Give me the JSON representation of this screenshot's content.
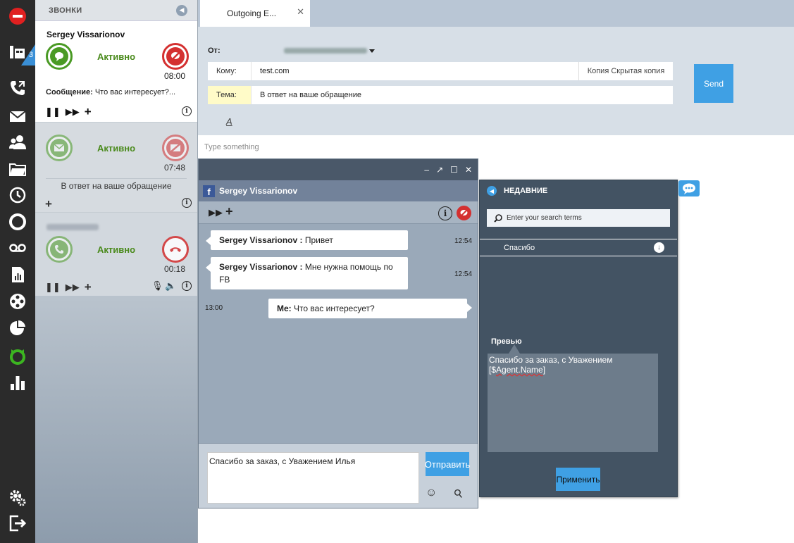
{
  "rail": {
    "badge_count": "3",
    "items": [
      "logout-top-icon",
      "calls-icon",
      "phone-icon",
      "email-icon",
      "contacts-icon",
      "folder-icon",
      "history-icon",
      "lifebuoy-icon",
      "voicemail-icon",
      "report-icon",
      "film-icon",
      "pie-chart-icon",
      "refresh-icon",
      "bar-chart-icon",
      "settings-icon",
      "exit-icon"
    ]
  },
  "calls": {
    "header": "ЗВОНКИ",
    "cards": [
      {
        "name": "Sergey Vissarionov",
        "status": "Активно",
        "time": "08:00",
        "message_label": "Сообщение:",
        "message": "Что вас интересует?..."
      },
      {
        "status": "Активно",
        "time": "07:48",
        "subject": "В ответ на ваше обращение"
      },
      {
        "status": "Активно",
        "time": "00:18"
      }
    ]
  },
  "tabs": [
    {
      "label": "Outgoing E...",
      "close": "✕"
    }
  ],
  "compose": {
    "from_label": "От:",
    "to_label": "Кому:",
    "to_value": "test.com",
    "cc_label": "Копия Скрытая копия",
    "subject_label": "Тема:",
    "subject_value": "В ответ на ваше обращение",
    "send_label": "Send",
    "font_button": "A",
    "body_placeholder": "Type something"
  },
  "chat": {
    "title": "Sergey Vissarionov",
    "window_controls": [
      "–",
      "↗",
      "☐",
      "✕"
    ],
    "messages": [
      {
        "sender": "Sergey Vissarionov :",
        "text": "Привет",
        "time": "12:54"
      },
      {
        "sender": "Sergey Vissarionov :",
        "text": "Мне нужна помощь по FB",
        "time": "12:54"
      },
      {
        "sender": "Me:",
        "text": "Что вас интересует?",
        "time": "13:00"
      }
    ],
    "input_value": "Спасибо за заказ, с Уважением Илья",
    "send_label": "Отправить"
  },
  "recent": {
    "title": "НЕДАВНИЕ",
    "search_placeholder": "Enter your search terms",
    "template_name": "Спасибо",
    "preview_label": "Превью",
    "preview_text_1": "Спасибо за заказ, с Уважением",
    "preview_text_2_pre": "[$",
    "preview_text_2_var": "Agent.Name",
    "preview_text_2_post": "]",
    "apply_label": "Применить"
  },
  "colors": {
    "accent": "#3fa0e4",
    "active_green": "#4a9a24",
    "hangup_red": "#d43030"
  }
}
